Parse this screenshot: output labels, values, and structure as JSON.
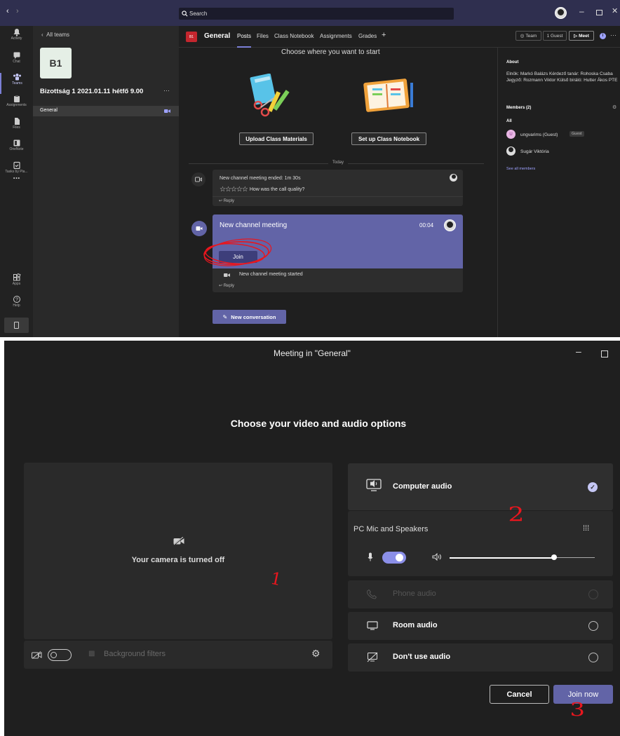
{
  "teams": {
    "search_placeholder": "Search",
    "rail": [
      {
        "label": "Activity",
        "icon": "bell-icon"
      },
      {
        "label": "Chat",
        "icon": "chat-icon"
      },
      {
        "label": "Teams",
        "icon": "teams-icon"
      },
      {
        "label": "Assignments",
        "icon": "assignments-icon"
      },
      {
        "label": "Files",
        "icon": "files-icon"
      },
      {
        "label": "OneNote",
        "icon": "onenote-icon"
      },
      {
        "label": "Tasks by Pla...",
        "icon": "tasks-icon"
      },
      {
        "label": "...",
        "icon": "more-icon"
      },
      {
        "label": "Apps",
        "icon": "apps-icon"
      },
      {
        "label": "Help",
        "icon": "help-icon"
      }
    ],
    "left_panel": {
      "back_label": "All teams",
      "team_initials": "B1",
      "team_name": "Bizottság 1 2021.01.11 hétfő 9.00",
      "more": "···",
      "channel": "General"
    },
    "header": {
      "badge": "B1",
      "channel_name": "General",
      "tabs": [
        "Posts",
        "Files",
        "Class Notebook",
        "Assignments",
        "Grades"
      ],
      "add_tab": "+",
      "team_btn": "Team",
      "guest_btn": "1 Guest",
      "meet_btn": "Meet",
      "more": "···"
    },
    "feed": {
      "choose_title": "Choose where you want to start",
      "upload_btn": "Upload Class Materials",
      "notebook_btn": "Set up Class Notebook",
      "today": "Today",
      "ended_title": "New channel meeting ended: 1m 30s",
      "quality_question": "How was the call quality?",
      "reply1": "Reply",
      "meeting_title": "New channel meeting",
      "meeting_time": "00:04",
      "join_btn": "Join",
      "started": "New channel meeting started",
      "reply2": "Reply",
      "new_conversation": "New conversation"
    },
    "about": {
      "title": "About",
      "description": "Elnök: Markó Balázs Kérdező tanár: Rohoska Csaba Jegyző: Rozmann Viktor Külső bíráló: Hutter Ákos PTE",
      "members_title": "Members (2)",
      "all_label": "All",
      "member1": "ungvarims (Guest)",
      "member1_badge": "Guest",
      "member1_initial": "U",
      "member2": "Sugár Viktória",
      "see_all": "See all members"
    }
  },
  "meeting": {
    "window_title": "Meeting in \"General\"",
    "heading": "Choose your video and audio options",
    "camera_off": "Your camera is turned off",
    "background_filters": "Background filters",
    "computer_audio": "Computer audio",
    "device_name": "PC Mic and Speakers",
    "volume_level": 0.72,
    "phone_audio": "Phone audio",
    "room_audio": "Room audio",
    "no_audio": "Don't use audio",
    "cancel": "Cancel",
    "join_now": "Join now"
  },
  "annotations": {
    "one": "1",
    "two": "2",
    "three": "3"
  },
  "colors": {
    "accent": "#6264a7",
    "annotation_red": "#e8161e",
    "teams_bg": "#1f1f1f",
    "meeting_bg": "#1f1f1f"
  }
}
